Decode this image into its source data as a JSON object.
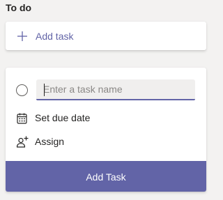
{
  "bucket": {
    "title": "To do"
  },
  "add_task_card": {
    "label": "Add task",
    "icon": "plus-icon"
  },
  "new_task_card": {
    "task_name_placeholder": "Enter a task name",
    "task_name_value": "",
    "complete_icon": "circle-icon",
    "due_date": {
      "label": "Set due date",
      "icon": "calendar-icon"
    },
    "assign": {
      "label": "Assign",
      "icon": "person-add-icon"
    },
    "submit_label": "Add Task"
  },
  "colors": {
    "accent": "#6264a7",
    "background": "#f3f2f1",
    "card": "#ffffff",
    "input_background": "#f0efee",
    "text": "#252423"
  }
}
